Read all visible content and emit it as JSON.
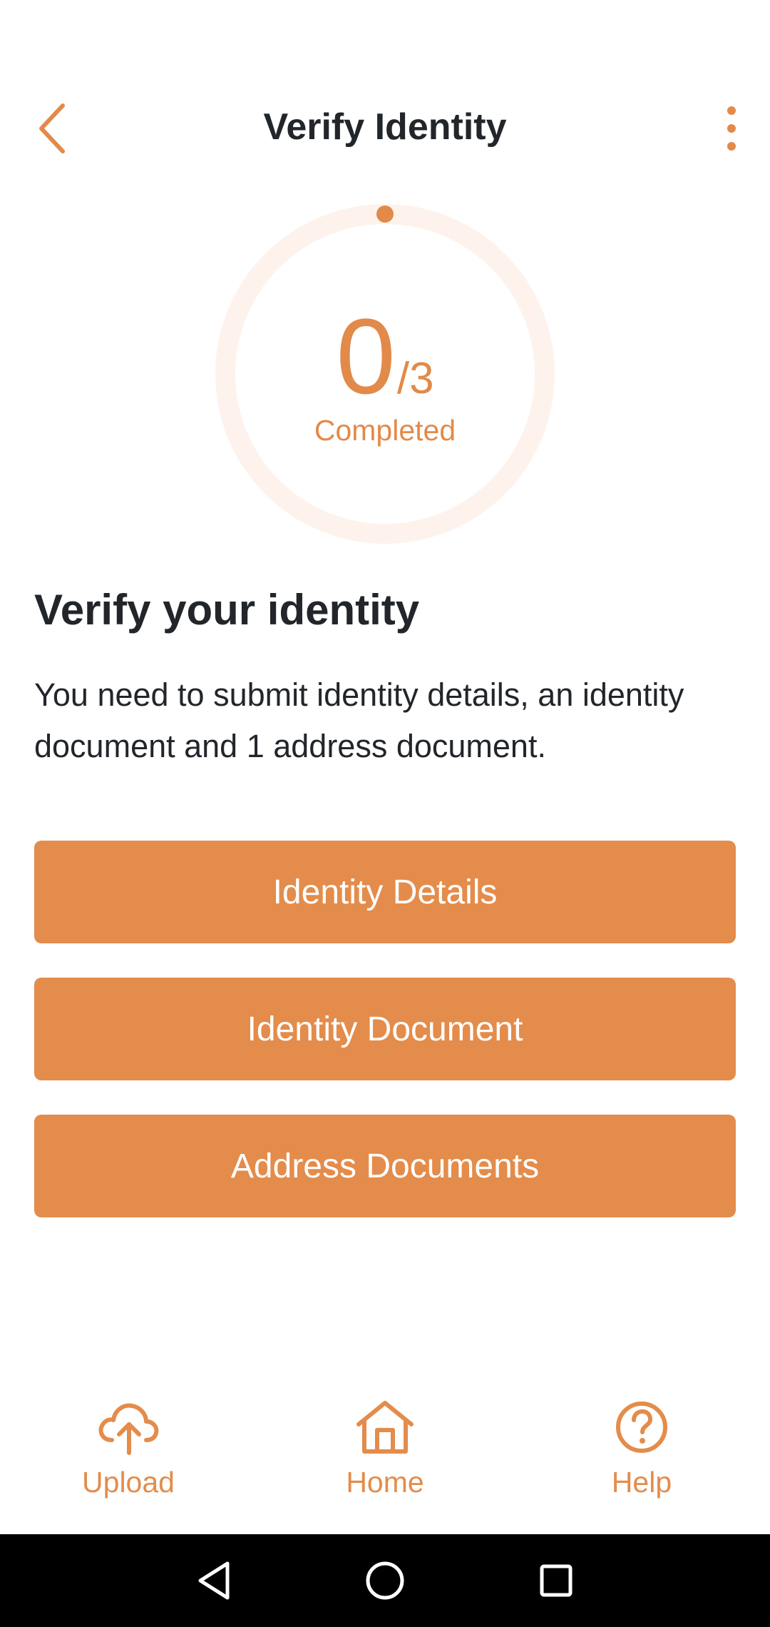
{
  "app_bar": {
    "title": "Verify Identity",
    "back_icon": "chevron-left-icon",
    "menu_icon": "more-vertical-icon"
  },
  "progress": {
    "completed": "0",
    "total": "/3",
    "label": "Completed",
    "fraction": 0
  },
  "content": {
    "heading": "Verify your identity",
    "description": "You need to submit identity details, an identity document and 1 address document."
  },
  "buttons": [
    {
      "label": "Identity Details"
    },
    {
      "label": "Identity Document"
    },
    {
      "label": "Address Documents"
    }
  ],
  "bottom_nav": [
    {
      "label": "Upload",
      "icon": "cloud-upload-icon"
    },
    {
      "label": "Home",
      "icon": "home-icon"
    },
    {
      "label": "Help",
      "icon": "help-circle-icon"
    }
  ],
  "colors": {
    "accent": "#e48c4b",
    "ring_track": "#fdf3ec",
    "text": "#22262b"
  }
}
